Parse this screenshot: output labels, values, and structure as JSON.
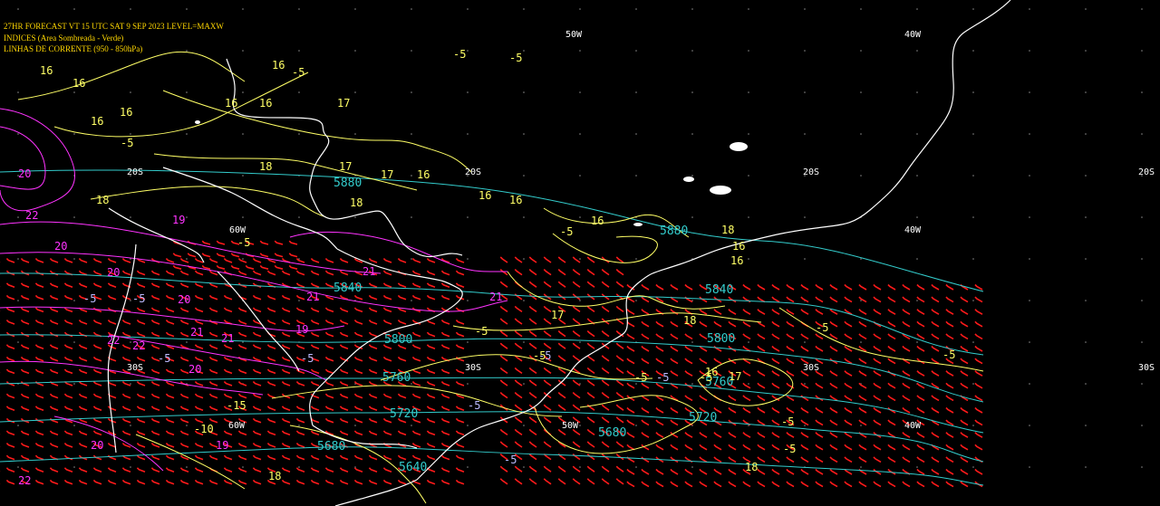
{
  "header": {
    "line1": "27HR FORECAST   VT 15 UTC SAT  9 SEP 2023   LEVEL=MAXW",
    "line2": "INDICES (Area Sombreada - Verde)",
    "line3": "LINHAS DE CORRENTE (950 - 850hPa)"
  },
  "colors": {
    "background": "#000000",
    "coast": "#ffffff",
    "header": "#ffd700",
    "theta_contour": "#ffff66",
    "height_contour": "#33cccc",
    "index_contour": "#ff33ff",
    "wind_barb": "#ff1a1a",
    "grid_label": "#ffffff"
  },
  "grid_labels": [
    {
      "text": "50W"
    },
    {
      "text": "40W"
    },
    {
      "text": "60W"
    },
    {
      "text": "40W"
    },
    {
      "text": "50W"
    },
    {
      "text": "40W"
    },
    {
      "text": "20S"
    },
    {
      "text": "20S"
    },
    {
      "text": "20S"
    },
    {
      "text": "20S"
    },
    {
      "text": "30S"
    },
    {
      "text": "30S"
    },
    {
      "text": "30S"
    },
    {
      "text": "30S"
    },
    {
      "text": "60W"
    }
  ],
  "height_labels": [
    "5880",
    "5880",
    "5840",
    "5840",
    "5800",
    "5800",
    "5760",
    "5760",
    "5720",
    "5720",
    "5680",
    "5680",
    "5640"
  ],
  "yellow_labels": [
    "16",
    "16",
    "16",
    "16",
    "17",
    "16",
    "16",
    "16",
    "-5",
    "-5",
    "-5",
    "-5",
    "17",
    "18",
    "18",
    "18",
    "17",
    "16",
    "16",
    "16",
    "16",
    "-5",
    "18",
    "-5",
    "16",
    "16",
    "-5",
    "-5",
    "18",
    "17",
    "-5",
    "-5",
    "16",
    "17",
    "-5",
    "-5",
    "-10",
    "-15",
    "18",
    "18",
    "-5",
    "-5"
  ],
  "magenta_labels": [
    "19",
    "20",
    "20",
    "21",
    "21",
    "19",
    "22",
    "22",
    "21",
    "21",
    "21",
    "20",
    "20",
    "19",
    "22",
    "20",
    "22",
    "20"
  ],
  "cyan_small_labels": [
    "-5",
    "-5",
    "-5",
    "-5",
    "-5",
    "-5",
    "-5",
    "-5"
  ]
}
